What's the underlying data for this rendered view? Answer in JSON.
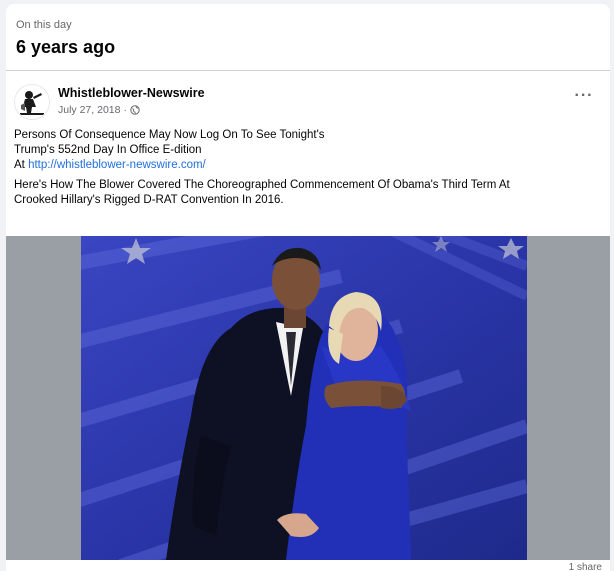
{
  "memory": {
    "kicker": "On this day",
    "title": "6 years ago"
  },
  "post": {
    "author": "Whistleblower-Newswire",
    "date": "July 27, 2018",
    "meta_separator": "·",
    "privacy_icon": "globe-icon",
    "more_label": "···",
    "lines": [
      "Persons Of Consequence May Now Log On To See Tonight's",
      "Trump's 552nd Day In Office E-dition"
    ],
    "link_prefix": "At ",
    "link_text": "http://whistleblower-newswire.com/",
    "paragraph2": [
      "Here's How The Blower Covered The Choreographed Commencement Of Obama's Third Term At",
      "Crooked Hillary's Rigged D-RAT Convention In 2016."
    ],
    "photo_icon": "photo-two-people-embracing-on-stage",
    "share_count": "1 share"
  },
  "colors": {
    "page_bg": "#f0f2f5",
    "link": "#216fdb",
    "muted": "#65676b",
    "stage_blue": "#2a35a8"
  }
}
